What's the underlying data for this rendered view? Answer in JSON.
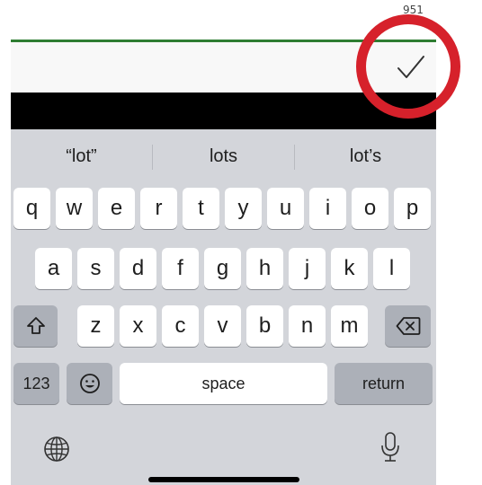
{
  "status": {
    "count_text": "951"
  },
  "toolbar": {
    "done_icon": "checkmark-icon"
  },
  "suggestions": [
    {
      "label": "“lot”"
    },
    {
      "label": "lots"
    },
    {
      "label": "lot’s"
    }
  ],
  "keyboard": {
    "row1": [
      "q",
      "w",
      "e",
      "r",
      "t",
      "y",
      "u",
      "i",
      "o",
      "p"
    ],
    "row2": [
      "a",
      "s",
      "d",
      "f",
      "g",
      "h",
      "j",
      "k",
      "l"
    ],
    "row3": [
      "z",
      "x",
      "c",
      "v",
      "b",
      "n",
      "m"
    ],
    "numbers_label": "123",
    "space_label": "space",
    "return_label": "return",
    "shift_icon": "shift-icon",
    "delete_icon": "backspace-icon",
    "emoji_icon": "emoji-icon",
    "globe_icon": "globe-icon",
    "mic_icon": "microphone-icon"
  },
  "colors": {
    "accent_line": "#2e7d32",
    "annotation_circle": "#d6212b",
    "keyboard_bg": "#d3d5da"
  }
}
